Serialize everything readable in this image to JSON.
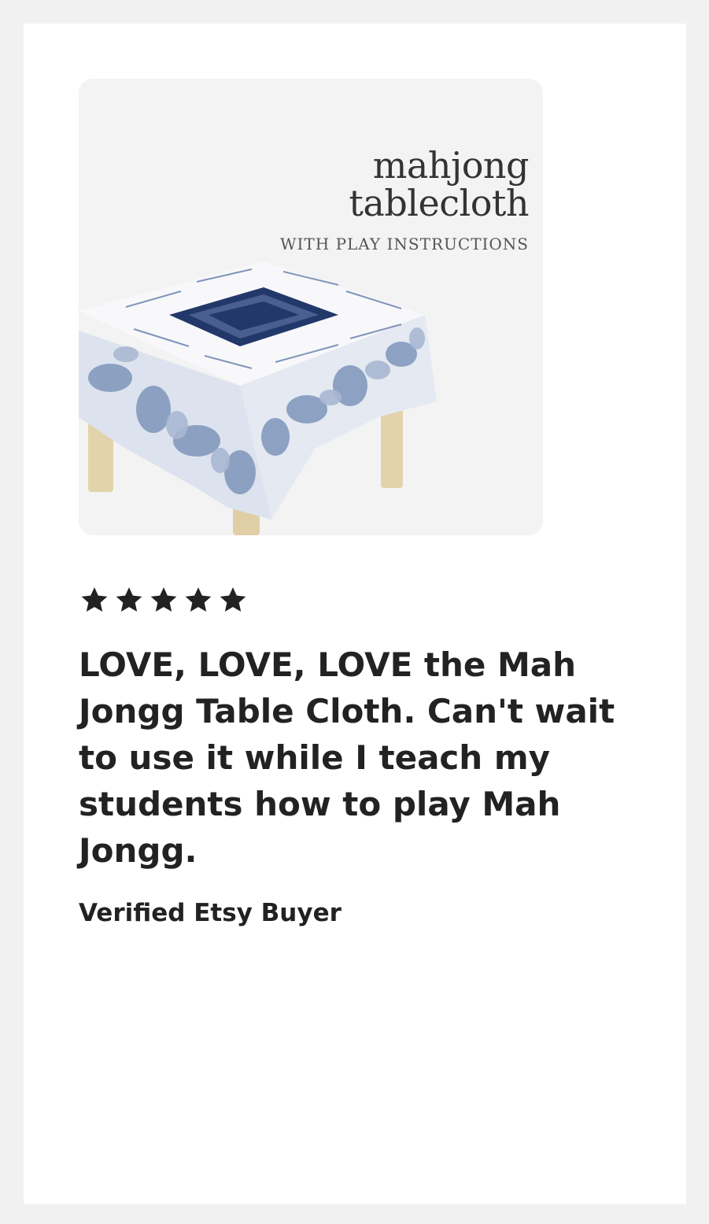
{
  "product": {
    "title_line1": "mahjong",
    "title_line2": "tablecloth",
    "subtitle": "WITH PLAY INSTRUCTIONS",
    "colors": {
      "pattern_blue": "#7f95bb",
      "dark_blue": "#22386a",
      "cloth_white": "#f8f8fa",
      "table_leg": "#e3d3ad",
      "background": "#f3f3f3"
    }
  },
  "review": {
    "rating": 5,
    "rating_max": 5,
    "text": "LOVE, LOVE, LOVE the Mah Jongg Table Cloth. Can't wait to use it while I teach my students how to play Mah Jongg.",
    "reviewer": "Verified Etsy Buyer"
  },
  "icons": {
    "star": "star-icon"
  }
}
